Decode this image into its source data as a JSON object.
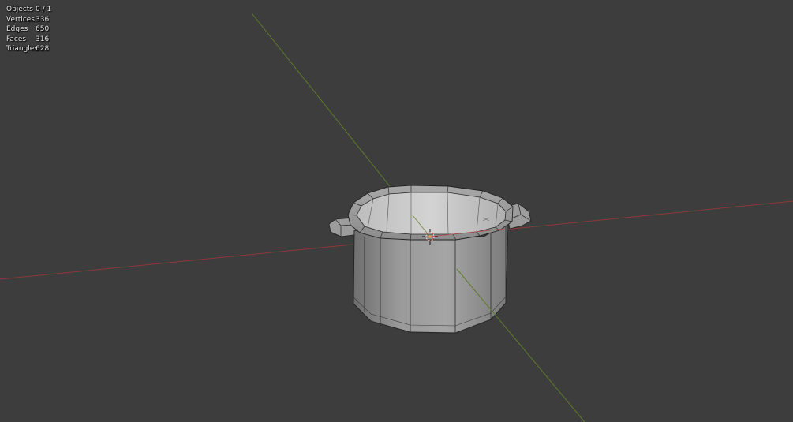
{
  "stats": {
    "objects": {
      "label": "Objects",
      "value": "0 / 1"
    },
    "vertices": {
      "label": "Vertices",
      "value": "336"
    },
    "edges": {
      "label": "Edges",
      "value": "650"
    },
    "faces": {
      "label": "Faces",
      "value": "316"
    },
    "triangles": {
      "label": "Triangles",
      "value": "628"
    }
  },
  "colors": {
    "background": "#3d3d3d",
    "x_axis": "#8a3a3a",
    "y_axis": "#5e7a2a",
    "mesh_wire": "#202020",
    "pot_body": "#8a8a8a"
  },
  "icons": {
    "origin": "3d-cursor-icon"
  }
}
